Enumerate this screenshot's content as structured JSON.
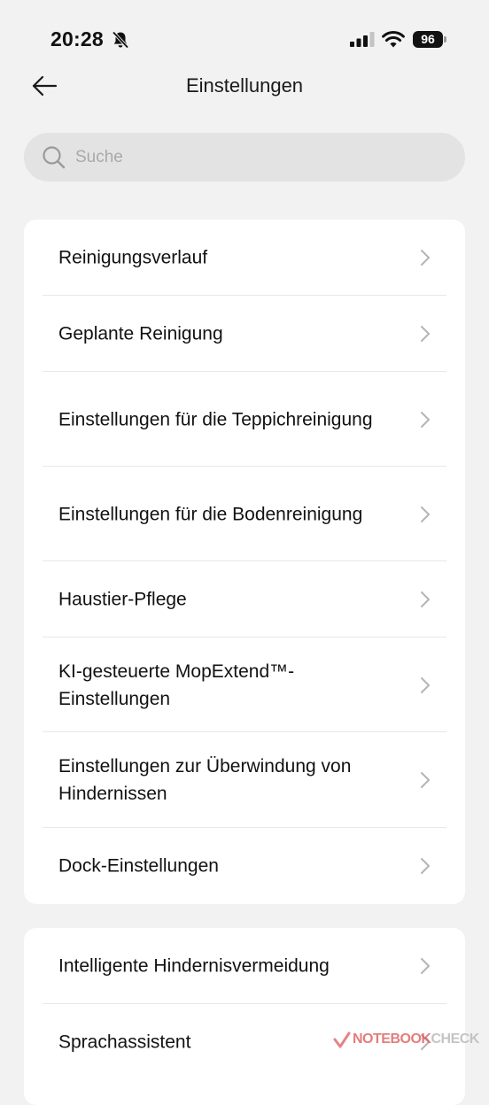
{
  "status_bar": {
    "time": "20:28",
    "battery": "96",
    "icons": [
      "bell-slash-icon",
      "cellular-signal-icon",
      "wifi-icon",
      "battery-icon"
    ]
  },
  "header": {
    "title": "Einstellungen",
    "back_icon": "arrow-left-icon"
  },
  "search": {
    "placeholder": "Suche",
    "value": ""
  },
  "settings_group_1": {
    "items": [
      {
        "label": "Reinigungsverlauf"
      },
      {
        "label": "Geplante Reinigung"
      },
      {
        "label": "Einstellungen für die Teppichreinigung"
      },
      {
        "label": "Einstellungen für die Bodenreinigung"
      },
      {
        "label": "Haustier-Pflege"
      },
      {
        "label": "KI-gesteuerte MopExtend™-Einstellungen"
      },
      {
        "label": "Einstellungen zur Überwindung von Hindernissen"
      },
      {
        "label": "Dock-Einstellungen"
      }
    ]
  },
  "settings_group_2": {
    "items": [
      {
        "label": "Intelligente Hindernisvermeidung"
      },
      {
        "label": "Sprachassistent"
      }
    ]
  },
  "watermark": {
    "part1": "NOTEBOOK",
    "part2": "CHECK"
  },
  "colors": {
    "background": "#f2f2f2",
    "card": "#ffffff",
    "search_field": "#e3e3e3",
    "chevron": "#b5b5b5"
  }
}
